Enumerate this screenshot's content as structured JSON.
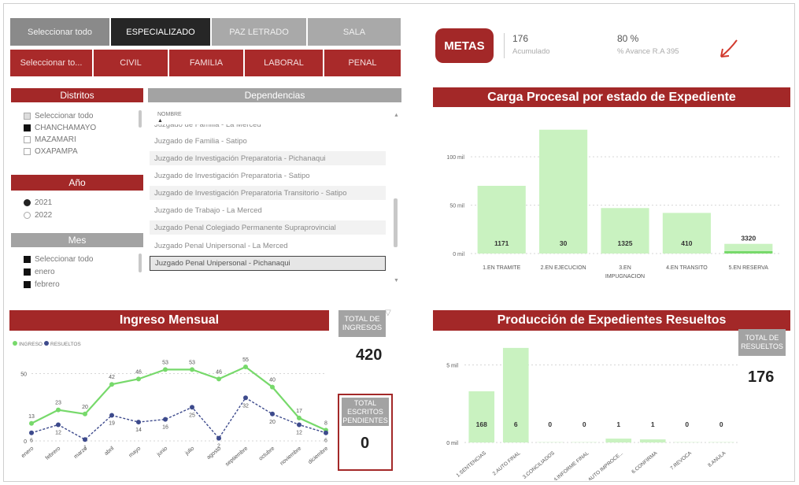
{
  "tipo_buttons": [
    {
      "label": "Seleccionar todo",
      "style": "gray"
    },
    {
      "label": "ESPECIALIZADO",
      "style": "dark"
    },
    {
      "label": "PAZ LETRADO",
      "style": "lgray"
    },
    {
      "label": "SALA",
      "style": "lgray"
    }
  ],
  "materia_buttons": [
    "Seleccionar to...",
    "CIVIL",
    "FAMILIA",
    "LABORAL",
    "PENAL"
  ],
  "distritos": {
    "header": "Distritos",
    "items": [
      {
        "label": "Seleccionar todo",
        "state": "partial"
      },
      {
        "label": "CHANCHAMAYO",
        "state": "checked"
      },
      {
        "label": "MAZAMARI",
        "state": "unchecked"
      },
      {
        "label": "OXAPAMPA",
        "state": "unchecked"
      }
    ]
  },
  "anio": {
    "header": "Año",
    "items": [
      {
        "label": "2021",
        "selected": true
      },
      {
        "label": "2022",
        "selected": false
      }
    ]
  },
  "mes": {
    "header": "Mes",
    "items": [
      "Seleccionar todo",
      "enero",
      "febrero"
    ]
  },
  "dependencias": {
    "header": "Dependencias",
    "column": "NOMBRE",
    "items": [
      "Juzgado de Familia - La Merced",
      "Juzgado de Familia - Satipo",
      "Juzgado de Investigación Preparatoria - Pichanaqui",
      "Juzgado de Investigación Preparatoria - Satipo",
      "Juzgado de Investigación Preparatoria Transitorio - Satipo",
      "Juzgado de Trabajo - La Merced",
      "Juzgado Penal Colegiado Permanente Supraprovincial",
      "Juzgado Penal Unipersonal - La Merced",
      "Juzgado Penal Unipersonal - Pichanaqui"
    ]
  },
  "metas": {
    "button": "METAS",
    "acumulado_value": "176",
    "acumulado_label": "Acumulado",
    "avance_value": "80 %",
    "avance_label": "% Avance R.A 395"
  },
  "carga": {
    "title": "Carga Procesal por estado de Expediente"
  },
  "ingreso": {
    "title": "Ingreso Mensual",
    "total_label": "TOTAL DE INGRESOS",
    "total_value": "420",
    "pendientes_label": "TOTAL ESCRITOS PENDIENTES",
    "pendientes_value": "0"
  },
  "produccion": {
    "title": "Producción de Expedientes Resueltos",
    "total_label": "TOTAL DE RESUELTOS",
    "total_value": "176"
  },
  "colors": {
    "brand_red": "#a32828",
    "bar_green": "#c9f2c0",
    "line_green": "#77d96b",
    "line_navy": "#3d4a8c",
    "gray_header": "#a3a3a3"
  },
  "chart_data": [
    {
      "type": "bar",
      "title": "Carga Procesal por estado de Expediente",
      "categories": [
        "1.EN TRAMITE",
        "2.EN EJECUCION",
        "3.EN IMPUGNACION",
        "4.EN TRANSITO",
        "5.EN RESERVA"
      ],
      "values": [
        70,
        128,
        47,
        42,
        10
      ],
      "data_labels": [
        "1171",
        "30",
        "1325",
        "410",
        "3320"
      ],
      "yticks": [
        "0 mil",
        "50 mil",
        "100 mil"
      ],
      "ylim": [
        0,
        140
      ],
      "grid": true
    },
    {
      "type": "line",
      "legend": [
        "INGRESO",
        "RESUELTOS"
      ],
      "legend_position": "top-left",
      "categories": [
        "enero",
        "febrero",
        "marzo",
        "abril",
        "mayo",
        "junio",
        "julio",
        "agosto",
        "septiembre",
        "octubre",
        "noviembre",
        "diciembre"
      ],
      "yticks": [
        "0",
        "50"
      ],
      "ylim": [
        0,
        62
      ],
      "series": [
        {
          "name": "INGRESO",
          "values": [
            13,
            23,
            20,
            42,
            46,
            53,
            53,
            46,
            55,
            40,
            17,
            8
          ]
        },
        {
          "name": "RESUELTOS",
          "values": [
            6,
            12,
            1,
            19,
            14,
            16,
            25,
            2,
            32,
            20,
            12,
            6
          ]
        }
      ]
    },
    {
      "type": "bar",
      "title": "Producción de Expedientes Resueltos",
      "categories": [
        "1.SENTENCIAS",
        "2.AUTO FINAL",
        "3.CONCILIADOS",
        "4.INFORME FINAL",
        "5.AUTO IMPROCE...",
        "6.CONFIRMA",
        "7.REVOCA",
        "8.ANULA"
      ],
      "values": [
        168,
        6,
        0,
        0,
        1,
        1,
        0,
        0
      ],
      "yticks": [
        "0 mil",
        "5 mil"
      ],
      "ylim": [
        0,
        6.5
      ],
      "grid": true
    }
  ]
}
